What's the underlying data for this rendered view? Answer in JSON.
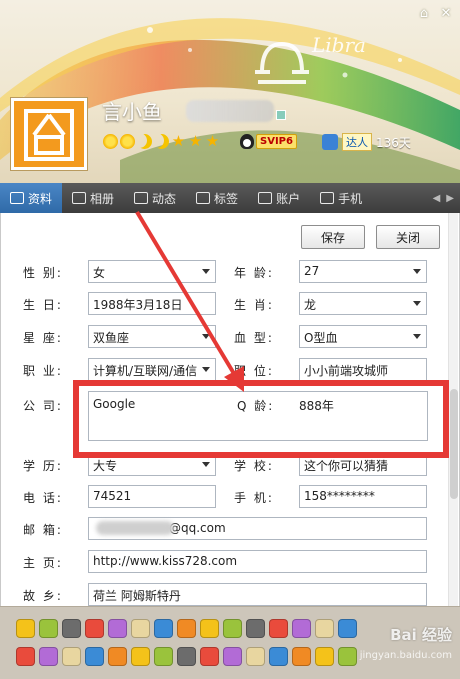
{
  "window": {
    "controls": [
      "⌂",
      "✕"
    ]
  },
  "profile": {
    "nickname": "言小鱼",
    "skin_text": "Libra",
    "svip": "SVIP6",
    "daren": "达人",
    "days": "136天"
  },
  "tabs": [
    {
      "label": "资料",
      "icon": "id-card-icon"
    },
    {
      "label": "相册",
      "icon": "photo-album-icon"
    },
    {
      "label": "动态",
      "icon": "feed-icon"
    },
    {
      "label": "标签",
      "icon": "bookmark-icon"
    },
    {
      "label": "账户",
      "icon": "wallet-icon"
    },
    {
      "label": "手机",
      "icon": "phone-icon"
    }
  ],
  "tab_arrows": [
    "◀",
    "▶"
  ],
  "actions": {
    "save": "保存",
    "close": "关闭"
  },
  "fields": {
    "gender": {
      "label": "性  别:",
      "value": "女"
    },
    "age": {
      "label": "年  龄:",
      "value": "27"
    },
    "birthday": {
      "label": "生  日:",
      "value": "1988年3月18日"
    },
    "zodiac": {
      "label": "生  肖:",
      "value": "龙"
    },
    "constellation": {
      "label": "星  座:",
      "value": "双鱼座"
    },
    "blood": {
      "label": "血  型:",
      "value": "O型血"
    },
    "occupation": {
      "label": "职  业:",
      "value": "计算机/互联网/通信"
    },
    "position": {
      "label": "职  位:",
      "value": "小小前端攻城师"
    },
    "company": {
      "label": "公  司:",
      "value": "Google",
      "q_label": "Q  龄:",
      "q_value": "888年"
    },
    "education": {
      "label": "学  历:",
      "value": "大专"
    },
    "school": {
      "label": "学  校:",
      "value": "这个你可以猜猜"
    },
    "phone": {
      "label": "电  话:",
      "value": "74521"
    },
    "mobile": {
      "label": "手  机:",
      "value": "158********"
    },
    "email": {
      "label": "邮  箱:",
      "value": "@qq.com"
    },
    "homepage": {
      "label": "主  页:",
      "value": "http://www.kiss728.com"
    },
    "hometown": {
      "label": "故  乡:",
      "value": "荷兰  阿姆斯特丹"
    }
  },
  "watermark": {
    "main": "Bai 经验",
    "sub": "jingyan.baidu.com"
  },
  "colors": {
    "annotation_red": "#e53935",
    "avatar_orange": "#f39a1e",
    "tab_active": "#3a78b8"
  }
}
